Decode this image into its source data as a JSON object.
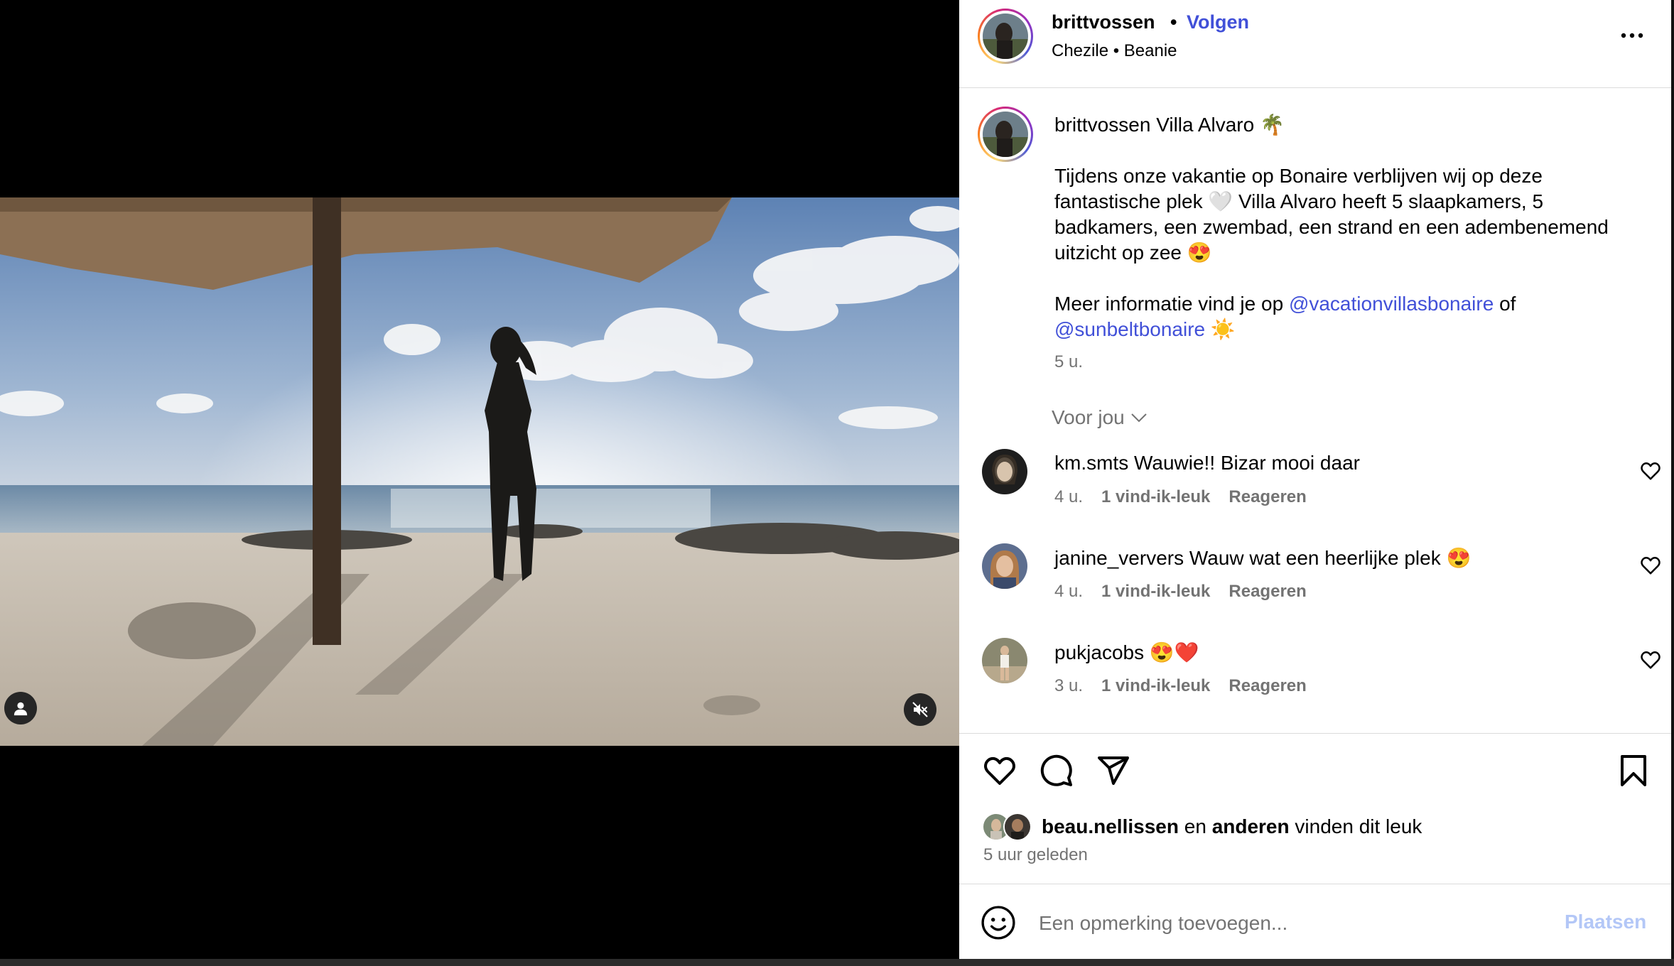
{
  "post": {
    "username": "brittvossen",
    "separator": "•",
    "follow_label": "Volgen",
    "subtitle_left": "Chezile",
    "subtitle_right": "Beanie"
  },
  "caption": {
    "username": "brittvossen",
    "title": "Villa Alvaro 🌴",
    "line1": "Tijdens onze vakantie op Bonaire verblijven wij op deze fantastische plek 🤍 Villa Alvaro heeft 5 slaapkamers, 5 badkamers, een zwembad, een strand en een adembenemend uitzicht op zee 😍",
    "more_prefix": "Meer informatie vind je op",
    "mention1": "@vacationvillasbonaire",
    "or_word": "of",
    "mention2": "@sunbeltbonaire",
    "more_suffix": "☀️",
    "time": "5 u."
  },
  "comments_filter": {
    "label": "Voor jou"
  },
  "comments": [
    {
      "username": "km.smts",
      "text": "Wauwie!! Bizar mooi daar",
      "time": "4 u.",
      "likes": "1 vind-ik-leuk",
      "reply": "Reageren"
    },
    {
      "username": "janine_ververs",
      "text": "Wauw wat een heerlijke plek 😍",
      "time": "4 u.",
      "likes": "1 vind-ik-leuk",
      "reply": "Reageren"
    },
    {
      "username": "pukjacobs",
      "text": "😍❤️",
      "time": "3 u.",
      "likes": "1 vind-ik-leuk",
      "reply": "Reageren"
    }
  ],
  "likes_line": {
    "user": "beau.nellissen",
    "and_word": "en",
    "others": "anderen",
    "suffix": "vinden dit leuk"
  },
  "posted_time": "5 uur geleden",
  "add_comment": {
    "placeholder": "Een opmerking toevoegen...",
    "post_label": "Plaatsen"
  },
  "icons": {
    "more": "more-dots-icon",
    "like": "heart-icon",
    "comment": "speech-bubble-icon",
    "share": "paper-plane-icon",
    "save": "bookmark-icon",
    "emoji": "smiley-icon",
    "tag": "person-icon",
    "mute": "speaker-muted-icon",
    "chevron": "chevron-down-icon"
  },
  "colors": {
    "link": "#4150d8",
    "muted": "#737373",
    "post_disabled": "#b3c7f7",
    "divider": "#dbdbdb"
  }
}
